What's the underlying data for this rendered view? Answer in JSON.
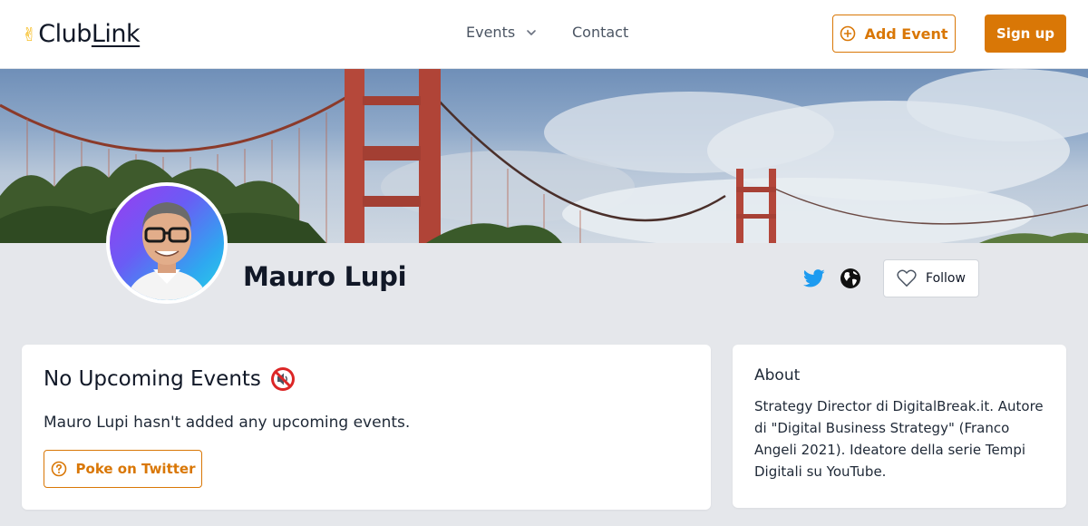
{
  "header": {
    "logo_prefix": "Club",
    "logo_suffix": "Link",
    "logo_icon": "victory-hand-icon",
    "nav": {
      "events_label": "Events",
      "contact_label": "Contact"
    },
    "add_event_label": "Add Event",
    "sign_up_label": "Sign up"
  },
  "banner": {
    "image": "golden-gate-bridge-photo"
  },
  "profile": {
    "name": "Mauro Lupi",
    "avatar": "profile-photo",
    "follow_label": "Follow",
    "social_icons": [
      "twitter-icon",
      "globe-icon"
    ]
  },
  "events": {
    "title": "No Upcoming Events",
    "title_icon": "muted-speaker-icon",
    "message": "Mauro Lupi hasn't added any upcoming events.",
    "poke_label": "Poke on Twitter"
  },
  "about": {
    "title": "About",
    "text": "Strategy Director di DigitalBreak.it. Autore di \"Digital Business Strategy\" (Franco Angeli 2021). Ideatore della serie Tempi Digitali su YouTube."
  },
  "colors": {
    "accent": "#d97706",
    "page_background": "#e5e7eb",
    "twitter": "#1d9bf0"
  }
}
